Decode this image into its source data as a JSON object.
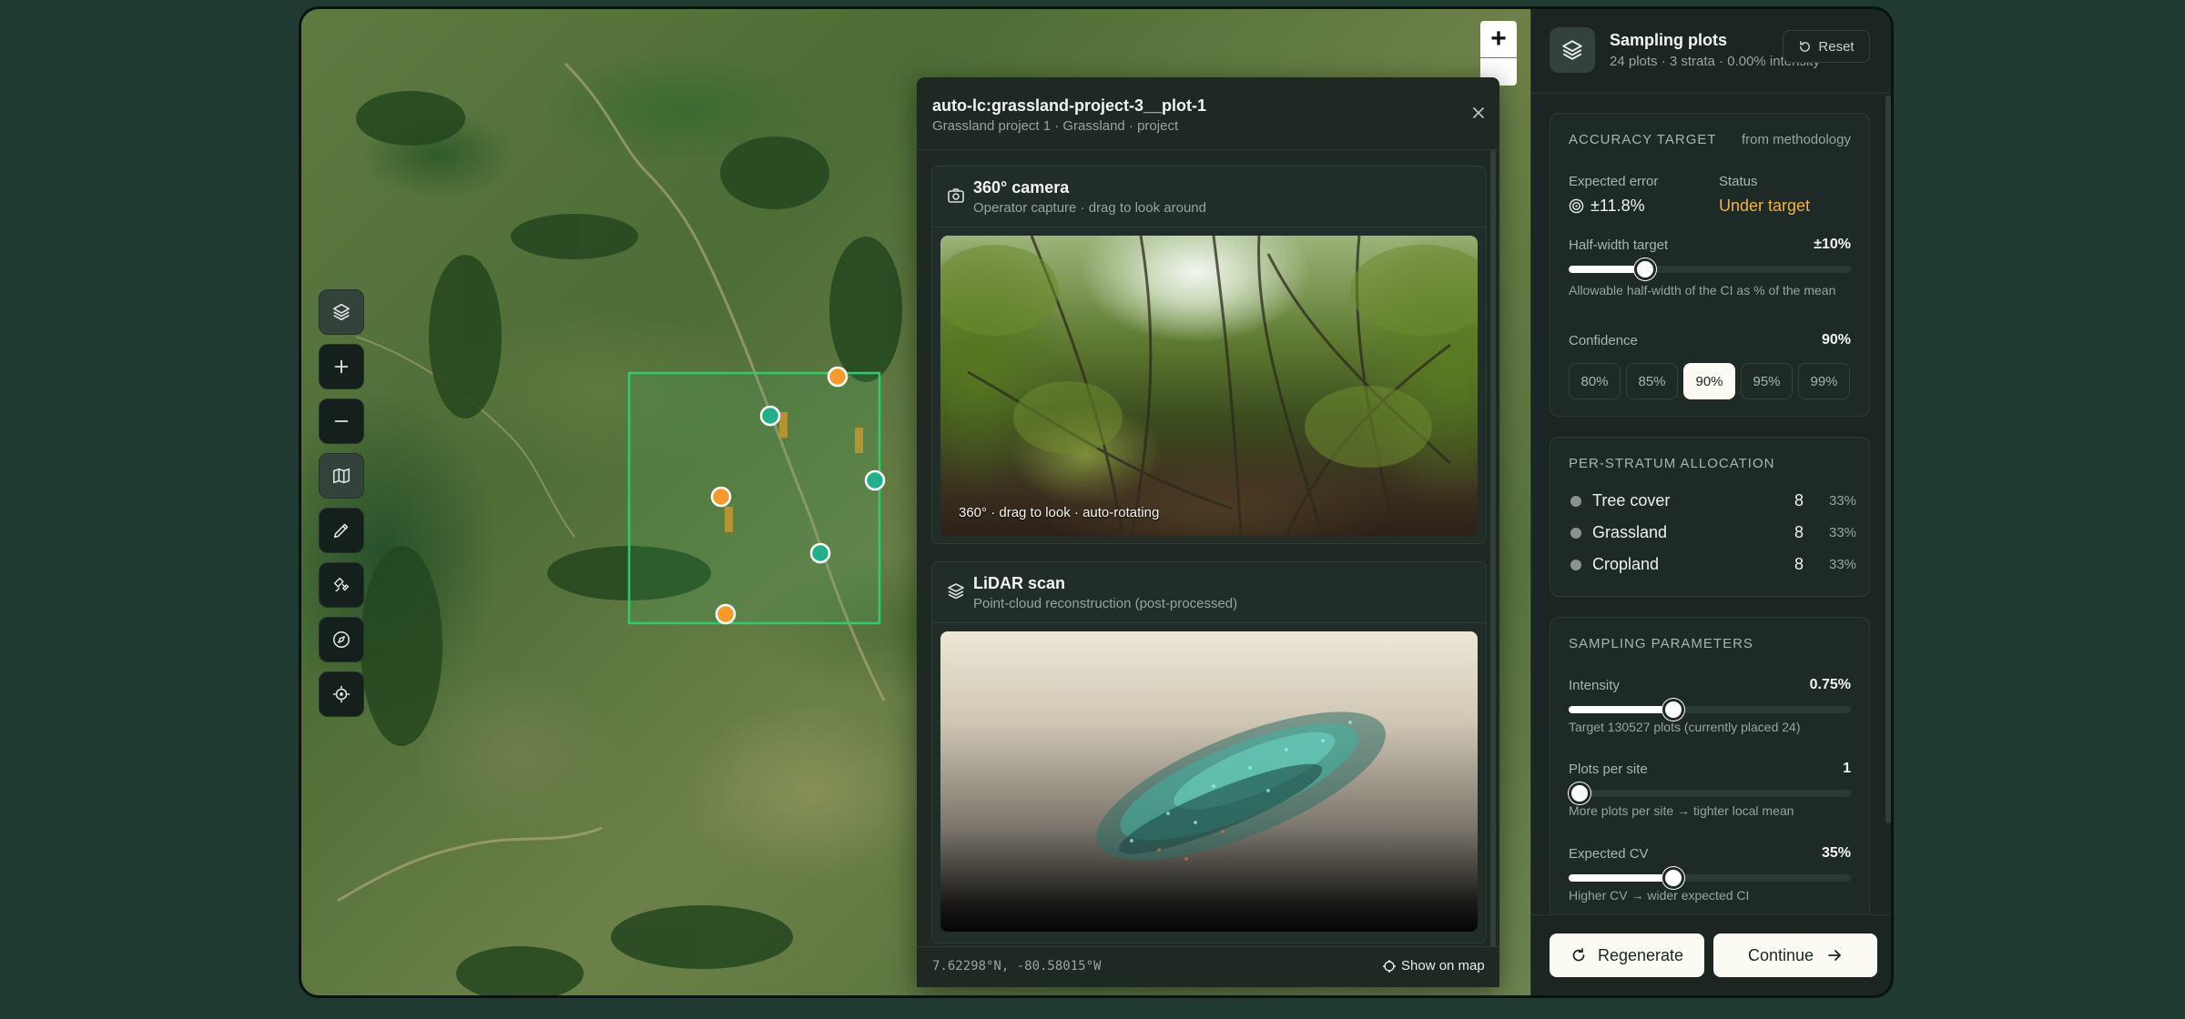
{
  "map": {
    "tools": [
      {
        "icon": "layers-icon",
        "active": true
      },
      {
        "icon": "plus-icon",
        "active": false
      },
      {
        "icon": "minus-icon",
        "active": false
      },
      {
        "icon": "map-icon",
        "active": true
      },
      {
        "icon": "pen-icon",
        "active": false
      },
      {
        "icon": "satellite-icon",
        "active": false
      },
      {
        "icon": "compass-icon",
        "active": false
      },
      {
        "icon": "locate-icon",
        "active": false
      }
    ],
    "zoom_in_label": "+",
    "colors": {
      "boundary": "#22c55e",
      "plot_teal": "#22b08a",
      "plot_orange": "#f59a2b"
    }
  },
  "detail": {
    "title": "auto-lc:grassland-project-3__plot-1",
    "subtitle": "Grassland project 1 · Grassland · project",
    "camera": {
      "title": "360° camera",
      "subtitle": "Operator capture · drag to look around",
      "overlay": "360° · drag to look · auto-rotating"
    },
    "lidar": {
      "title": "LiDAR scan",
      "subtitle": "Point-cloud reconstruction (post-processed)"
    },
    "coords": "7.62298°N, -80.58015°W",
    "show_on_map": "Show on map"
  },
  "sidebar": {
    "title": "Sampling plots",
    "subtitle": "24 plots · 3 strata · 0.00% intensity",
    "reset_label": "Reset",
    "accuracy": {
      "heading": "Accuracy target",
      "source": "from methodology",
      "expected_error_label": "Expected error",
      "expected_error_value": "±11.8%",
      "status_label": "Status",
      "status_value": "Under target",
      "half_width_label": "Half-width target",
      "half_width_value": "±10%",
      "half_width_fraction": 0.27,
      "half_width_hint": "Allowable half-width of the CI as % of the mean",
      "confidence_label": "Confidence",
      "confidence_value": "90%",
      "confidence_options": [
        "80%",
        "85%",
        "90%",
        "95%",
        "99%"
      ],
      "confidence_selected": 2
    },
    "strata": {
      "heading": "Per-stratum allocation",
      "rows": [
        {
          "name": "Tree cover",
          "count": "8",
          "pct": "33%"
        },
        {
          "name": "Grassland",
          "count": "8",
          "pct": "33%"
        },
        {
          "name": "Cropland",
          "count": "8",
          "pct": "33%"
        }
      ]
    },
    "params": {
      "heading": "Sampling parameters",
      "intensity_label": "Intensity",
      "intensity_value": "0.75%",
      "intensity_fraction": 0.37,
      "intensity_hint": "Target 130527 plots (currently placed 24)",
      "plots_label": "Plots per site",
      "plots_value": "1",
      "plots_fraction": 0.04,
      "plots_hint": "More plots per site → tighter local mean",
      "cv_label": "Expected CV",
      "cv_value": "35%",
      "cv_fraction": 0.37,
      "cv_hint": "Higher CV → wider expected CI"
    },
    "regenerate_label": "Regenerate",
    "continue_label": "Continue"
  }
}
